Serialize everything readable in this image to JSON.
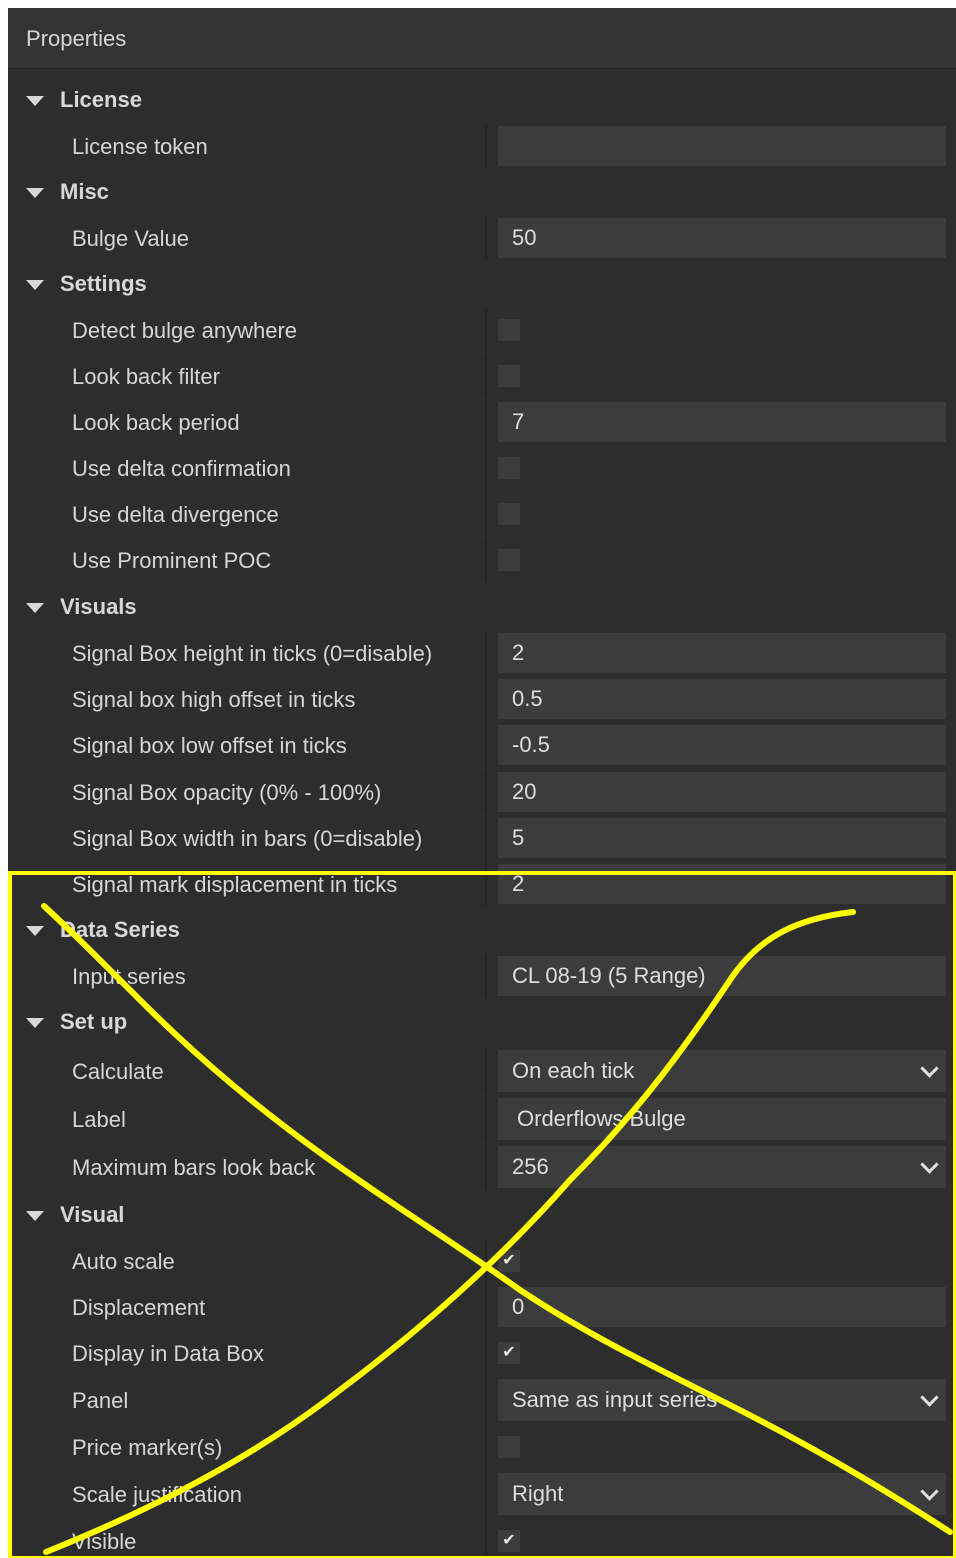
{
  "panel": {
    "title": "Properties"
  },
  "categories": {
    "license": "License",
    "misc": "Misc",
    "settings": "Settings",
    "visuals": "Visuals",
    "data_series": "Data Series",
    "set_up": "Set up",
    "visual": "Visual"
  },
  "properties": {
    "license_token": {
      "label": "License token",
      "value": ""
    },
    "bulge_value": {
      "label": "Bulge Value",
      "value": "50"
    },
    "detect_bulge_anywhere": {
      "label": "Detect bulge anywhere",
      "checked": false
    },
    "look_back_filter": {
      "label": "Look back filter",
      "checked": false
    },
    "look_back_period": {
      "label": "Look back period",
      "value": "7"
    },
    "use_delta_confirmation": {
      "label": "Use delta confirmation",
      "checked": false
    },
    "use_delta_divergence": {
      "label": "Use delta divergence",
      "checked": false
    },
    "use_prominent_poc": {
      "label": "Use Prominent POC",
      "checked": false
    },
    "signal_box_height": {
      "label": "Signal Box height in ticks (0=disable)",
      "value": "2"
    },
    "signal_box_high_offset": {
      "label": "Signal box high offset in ticks",
      "value": "0.5"
    },
    "signal_box_low_offset": {
      "label": "Signal box low offset in ticks",
      "value": "-0.5"
    },
    "signal_box_opacity": {
      "label": "Signal Box opacity (0% - 100%)",
      "value": "20"
    },
    "signal_box_width": {
      "label": "Signal Box width in bars (0=disable)",
      "value": "5"
    },
    "signal_mark_displacement": {
      "label": "Signal mark displacement in ticks",
      "value": "2"
    },
    "input_series": {
      "label": "Input series",
      "value": "CL 08-19 (5 Range)"
    },
    "calculate": {
      "label": "Calculate",
      "value": "On each tick"
    },
    "label": {
      "label": "Label",
      "value": "Orderflows Bulge"
    },
    "maximum_bars_look_back": {
      "label": "Maximum bars look back",
      "value": "256"
    },
    "auto_scale": {
      "label": "Auto scale",
      "checked": true,
      "mark": "✔"
    },
    "displacement": {
      "label": "Displacement",
      "value": "0"
    },
    "display_in_data_box": {
      "label": "Display in Data Box",
      "checked": true,
      "mark": "✔"
    },
    "panel": {
      "label": "Panel",
      "value": "Same as input series"
    },
    "price_markers": {
      "label": "Price marker(s)",
      "checked": false
    },
    "scale_justification": {
      "label": "Scale justification",
      "value": "Right"
    },
    "visible": {
      "label": "Visible",
      "checked": true,
      "mark": "✔"
    }
  },
  "icons": {
    "expand": "triangle-down-icon",
    "dropdown": "chevron-down-icon",
    "check": "checkmark-icon"
  },
  "annotation": {
    "color": "#ffff00"
  }
}
